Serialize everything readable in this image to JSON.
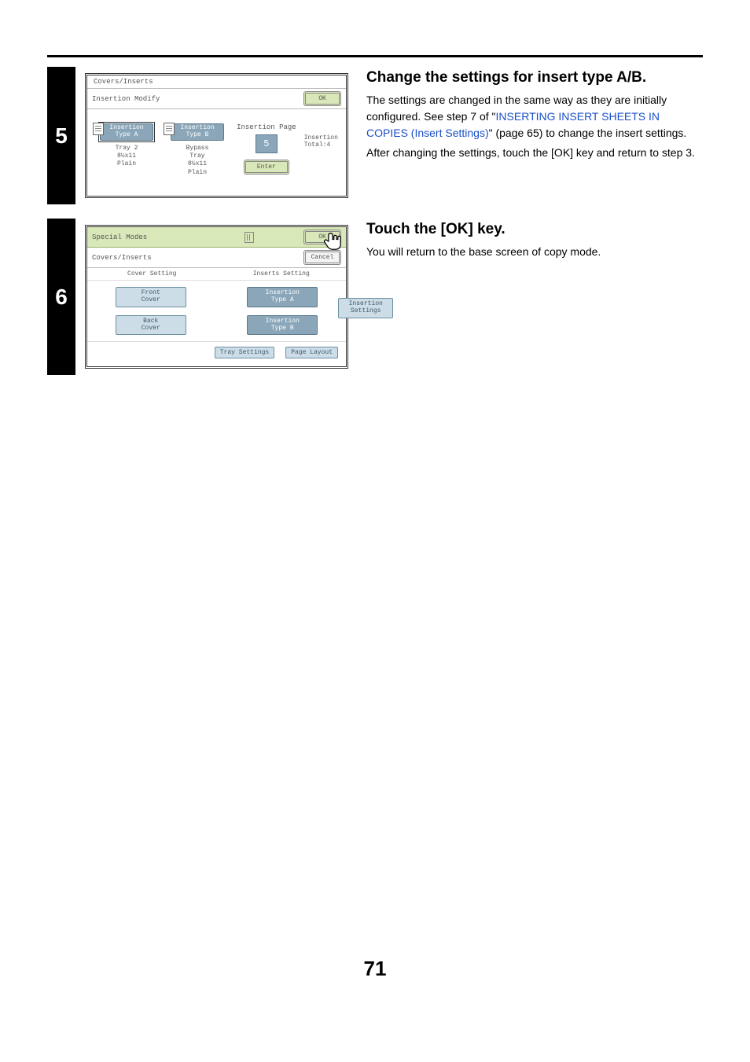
{
  "page_number": "71",
  "step5": {
    "number": "5",
    "heading": "Change the settings for insert type A/B.",
    "para1_a": "The settings are changed in the same way as they are initially configured. See step 7 of \"",
    "link_text": "INSERTING INSERT SHEETS IN COPIES (Insert Settings)",
    "para1_b": "\" (page 65) to change the insert settings.",
    "para2": "After changing the settings, touch the [OK] key and return to step 3.",
    "panel": {
      "title": "Covers/Inserts",
      "sub_label": "Insertion Modify",
      "ok": "OK",
      "optA_line1": "Insertion",
      "optA_line2": "Type A",
      "optA_meta1": "Tray 2",
      "optA_meta2": "8½x11",
      "optA_meta3": "Plain",
      "optB_line1": "Insertion",
      "optB_line2": "Type B",
      "optB_meta1": "Bypass",
      "optB_meta2": "Tray",
      "optB_meta3": "8½x11",
      "optB_meta4": "Plain",
      "ins_page_label": "Insertion Page",
      "ins_page_value": "5",
      "enter": "Enter",
      "side1": "Insertion",
      "side2": "Total:4"
    }
  },
  "step6": {
    "number": "6",
    "heading": "Touch the [OK] key.",
    "para": "You will return to the base screen of copy mode.",
    "panel": {
      "special_modes": "Special Modes",
      "ok": "OK",
      "breadcrumb": "Covers/Inserts",
      "cancel": "Cancel",
      "col1_header": "Cover Setting",
      "col2_header": "Inserts Setting",
      "front_cover_l1": "Front",
      "front_cover_l2": "Cover",
      "back_cover_l1": "Back",
      "back_cover_l2": "Cover",
      "ins_a_l1": "Insertion",
      "ins_a_l2": "Type A",
      "ins_b_l1": "Insertion",
      "ins_b_l2": "Type B",
      "ins_settings_l1": "Insertion",
      "ins_settings_l2": "Settings",
      "tray_settings": "Tray Settings",
      "page_layout": "Page Layout"
    }
  }
}
